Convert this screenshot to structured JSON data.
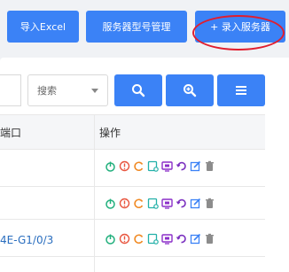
{
  "toolbar": {
    "import_excel": "导入Excel",
    "server_model_mgmt": "服务器型号管理",
    "add_server": "+ 录入服务器"
  },
  "search": {
    "select_value": "搜索"
  },
  "table": {
    "columns": [
      "端口",
      "操作"
    ],
    "rows": [
      {
        "port": ""
      },
      {
        "port": ""
      },
      {
        "port": "4E-G1/0/3"
      }
    ]
  },
  "colors": {
    "primary": "#3b82f6",
    "annotation": "#e11d2e",
    "power": "#22b07d",
    "info": "#e8553e",
    "refresh": "#f08a24",
    "console": "#22b0a8",
    "monitor": "#8b2fc9",
    "history": "#7a2fbf",
    "edit": "#3b82f6",
    "delete": "#8c8c8c"
  }
}
